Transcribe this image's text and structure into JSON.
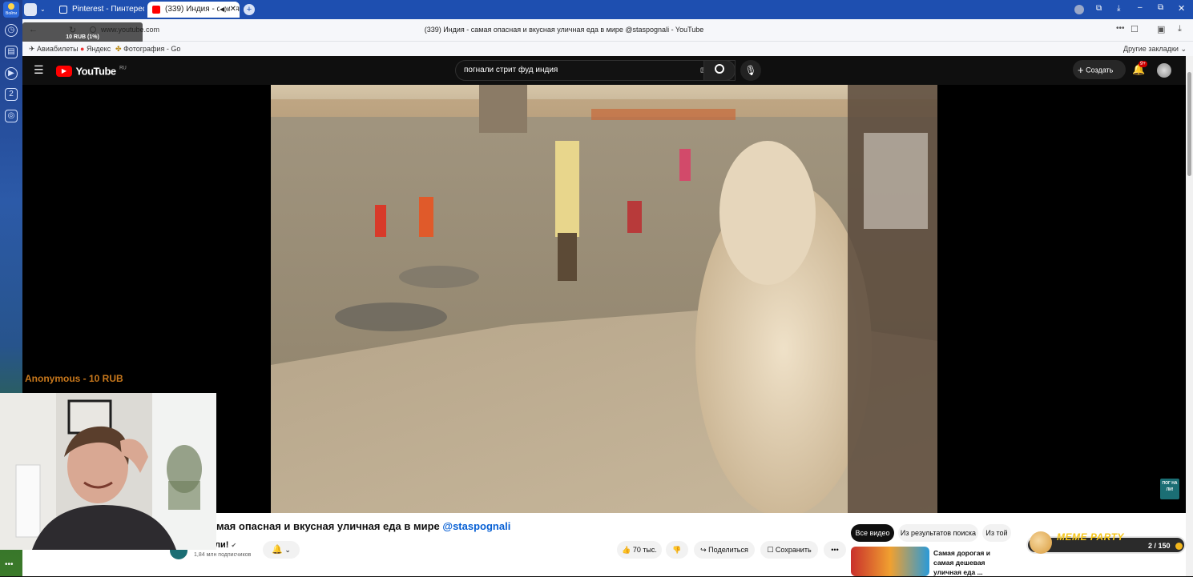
{
  "browser": {
    "tabs": [
      {
        "title": "Pinterest - Пинтерест",
        "active": false
      },
      {
        "title": "(339) Индия - самая",
        "active": true
      }
    ],
    "url": "www.youtube.com",
    "page_title": "(339) Индия - самая опасная и вкусная уличная еда в мире @staspognali - YouTube",
    "bookmarks": [
      "Авиабилеты",
      "Яндекс",
      "Фотография - Go"
    ],
    "other_bookmarks": "Другие закладки",
    "login_badge": "Войти",
    "rail_badge": "2"
  },
  "youtube": {
    "logo_text": "YouTube",
    "logo_region": "RU",
    "search_query": "погнали стрит фуд индия",
    "create_label": "Создать",
    "notif_count": "9+",
    "video_title": "мая опасная и вкусная уличная еда в мире ",
    "video_title_handle": "@staspognali",
    "channel_name": "ли!",
    "subscribers": "1,84 млн подписчиков",
    "likes": "70 тыс.",
    "share_label": "Поделиться",
    "save_label": "Сохранить",
    "watermark": "ПОГ НА ЛИ!",
    "chips": [
      "Все видео",
      "Из результатов поиска",
      "Из той"
    ],
    "recommendation_title": "Самая дорогая и самая дешевая уличная еда ..."
  },
  "overlay": {
    "donation_amount": "10 RUB (1%)",
    "donor_line": "Anonymous - 10 RUB",
    "meme_title": "MEME PARTY",
    "meme_counter": "2 / 150"
  },
  "colors": {
    "youtube_red": "#ff0000",
    "donation_orange": "#c8781c",
    "link_blue": "#065fd4",
    "browser_blue": "#1e4fb0"
  }
}
